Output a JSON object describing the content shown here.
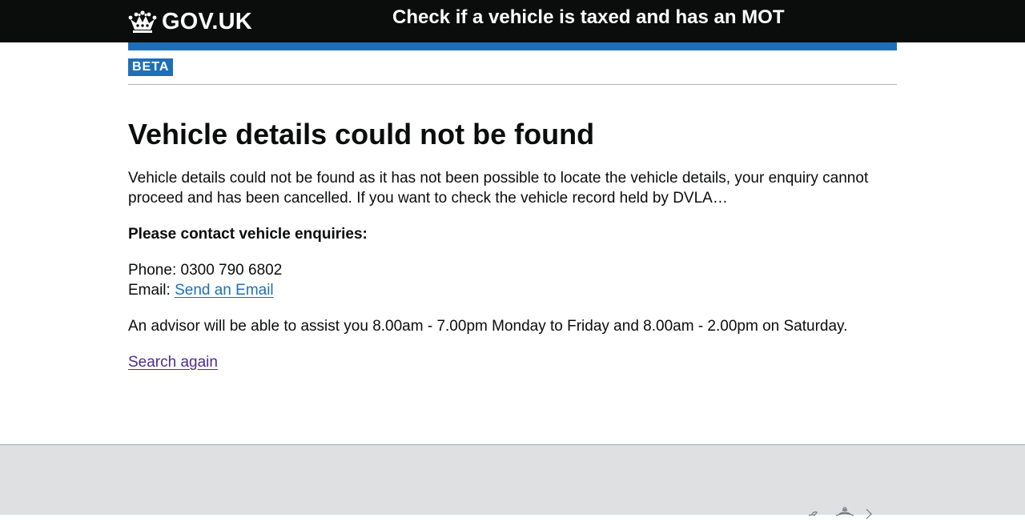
{
  "header": {
    "logo_text": "GOV.UK",
    "service_name": "Check if a vehicle is taxed and has an MOT"
  },
  "phase_banner": {
    "tag": "BETA"
  },
  "main": {
    "title": "Vehicle details could not be found",
    "intro": "Vehicle details could not be found as it has not been possible to locate the vehicle details, your enquiry cannot proceed and has been cancelled. If you want to check the vehicle record held by DVLA…",
    "contact_heading": "Please contact vehicle enquiries:",
    "phone_label": "Phone: ",
    "phone_number": "0300 790 6802",
    "email_label": "Email: ",
    "email_link": "Send an Email",
    "hours": "An advisor will be able to assist you 8.00am - 7.00pm Monday to Friday and 8.00am - 2.00pm on Saturday.",
    "search_again": "Search again"
  },
  "colors": {
    "header_bg": "#0b0c0c",
    "brand_blue": "#1d70b8",
    "link": "#1d70b8",
    "visited_link": "#4c2c92",
    "footer_bg": "#dee0e2"
  },
  "icons": {
    "logo": "crown-icon",
    "footer": "royal-crest-icon"
  }
}
